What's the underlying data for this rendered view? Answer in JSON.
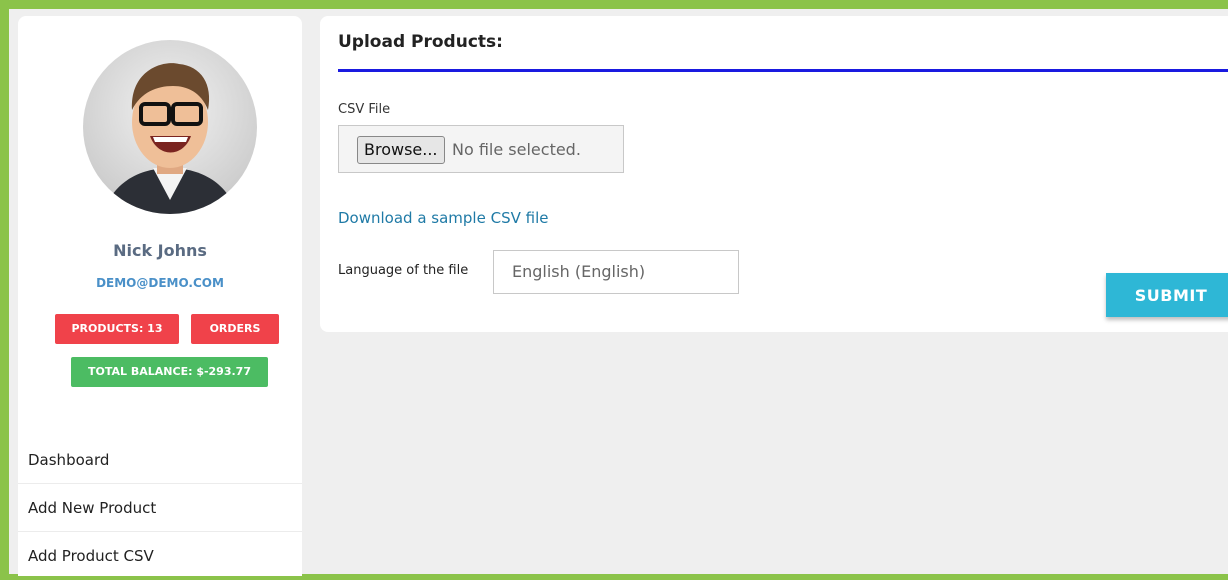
{
  "profile": {
    "name": "Nick Johns",
    "email": "DEMO@DEMO.COM",
    "products_badge": "PRODUCTS: 13",
    "orders_badge": "ORDERS",
    "balance_badge": "TOTAL BALANCE: $-293.77"
  },
  "sidebar": {
    "items": [
      {
        "label": "Dashboard"
      },
      {
        "label": "Add New Product"
      },
      {
        "label": "Add Product CSV"
      }
    ]
  },
  "upload": {
    "title": "Upload Products:",
    "csv_label": "CSV File",
    "browse_label": "Browse...",
    "file_status": "No file selected.",
    "sample_link": "Download a sample CSV file",
    "language_label": "Language of the file",
    "language_value": "English (English)",
    "submit_label": "SUBMIT"
  },
  "colors": {
    "frame_green": "#8bc34a",
    "badge_red": "#f0424a",
    "badge_green": "#4cbc63",
    "title_rule": "#1a1ae0",
    "submit": "#2eb7d6"
  }
}
